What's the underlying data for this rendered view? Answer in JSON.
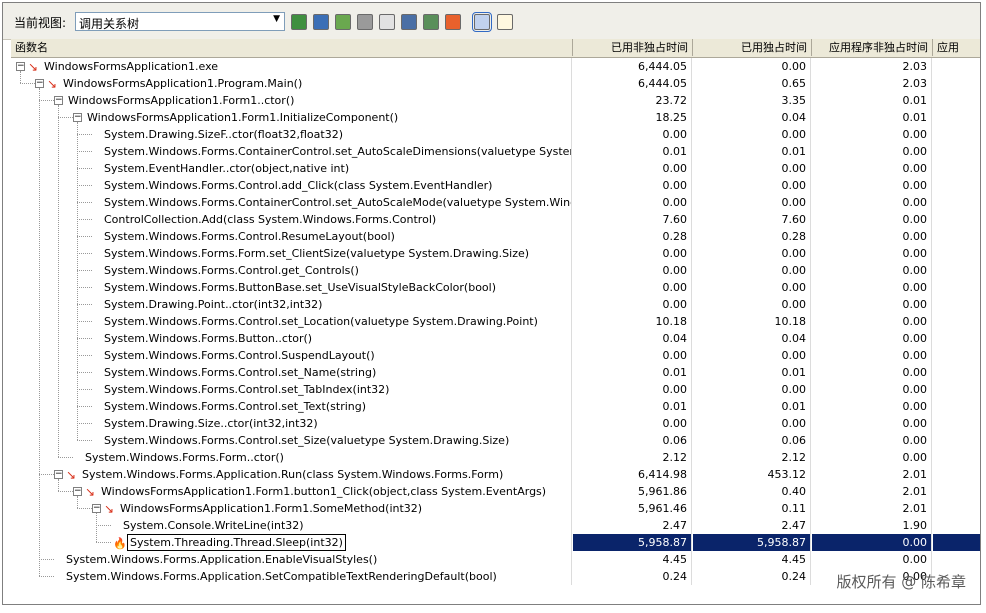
{
  "toolbar": {
    "view_label": "当前视图:",
    "view_value": "调用关系树",
    "buttons": [
      "export-icon",
      "copy-icon",
      "run-icon",
      "stop-icon",
      "find-icon",
      "compare-icon",
      "open-icon",
      "hotpath-icon",
      "flame-toggle-icon",
      "notes-icon"
    ]
  },
  "columns": [
    "函数名",
    "已用非独占时间",
    "已用独占时间",
    "应用程序非独占时间",
    "应用"
  ],
  "rows": [
    {
      "name": "WindowsFormsApplication1.exe",
      "v1": "6,444.05",
      "v2": "0.00",
      "v3": "2.03",
      "level": 0,
      "toggle": true,
      "hot": true
    },
    {
      "name": "WindowsFormsApplication1.Program.Main()",
      "v1": "6,444.05",
      "v2": "0.65",
      "v3": "2.03",
      "level": 1,
      "toggle": true,
      "hot": true
    },
    {
      "name": "WindowsFormsApplication1.Form1..ctor()",
      "v1": "23.72",
      "v2": "3.35",
      "v3": "0.01",
      "level": 2,
      "toggle": true,
      "hot": false
    },
    {
      "name": "WindowsFormsApplication1.Form1.InitializeComponent()",
      "v1": "18.25",
      "v2": "0.04",
      "v3": "0.01",
      "level": 3,
      "toggle": true,
      "hot": false
    },
    {
      "name": "System.Drawing.SizeF..ctor(float32,float32)",
      "v1": "0.00",
      "v2": "0.00",
      "v3": "0.00",
      "level": 4,
      "toggle": false,
      "hot": false
    },
    {
      "name": "System.Windows.Forms.ContainerControl.set_AutoScaleDimensions(valuetype System.Drawing",
      "v1": "0.01",
      "v2": "0.01",
      "v3": "0.00",
      "level": 4,
      "toggle": false,
      "hot": false
    },
    {
      "name": "System.EventHandler..ctor(object,native int)",
      "v1": "0.00",
      "v2": "0.00",
      "v3": "0.00",
      "level": 4,
      "toggle": false,
      "hot": false
    },
    {
      "name": "System.Windows.Forms.Control.add_Click(class System.EventHandler)",
      "v1": "0.00",
      "v2": "0.00",
      "v3": "0.00",
      "level": 4,
      "toggle": false,
      "hot": false
    },
    {
      "name": "System.Windows.Forms.ContainerControl.set_AutoScaleMode(valuetype System.Windows.Form",
      "v1": "0.00",
      "v2": "0.00",
      "v3": "0.00",
      "level": 4,
      "toggle": false,
      "hot": false
    },
    {
      "name": "ControlCollection.Add(class System.Windows.Forms.Control)",
      "v1": "7.60",
      "v2": "7.60",
      "v3": "0.00",
      "level": 4,
      "toggle": false,
      "hot": false
    },
    {
      "name": "System.Windows.Forms.Control.ResumeLayout(bool)",
      "v1": "0.28",
      "v2": "0.28",
      "v3": "0.00",
      "level": 4,
      "toggle": false,
      "hot": false
    },
    {
      "name": "System.Windows.Forms.Form.set_ClientSize(valuetype System.Drawing.Size)",
      "v1": "0.00",
      "v2": "0.00",
      "v3": "0.00",
      "level": 4,
      "toggle": false,
      "hot": false
    },
    {
      "name": "System.Windows.Forms.Control.get_Controls()",
      "v1": "0.00",
      "v2": "0.00",
      "v3": "0.00",
      "level": 4,
      "toggle": false,
      "hot": false
    },
    {
      "name": "System.Windows.Forms.ButtonBase.set_UseVisualStyleBackColor(bool)",
      "v1": "0.00",
      "v2": "0.00",
      "v3": "0.00",
      "level": 4,
      "toggle": false,
      "hot": false
    },
    {
      "name": "System.Drawing.Point..ctor(int32,int32)",
      "v1": "0.00",
      "v2": "0.00",
      "v3": "0.00",
      "level": 4,
      "toggle": false,
      "hot": false
    },
    {
      "name": "System.Windows.Forms.Control.set_Location(valuetype System.Drawing.Point)",
      "v1": "10.18",
      "v2": "10.18",
      "v3": "0.00",
      "level": 4,
      "toggle": false,
      "hot": false
    },
    {
      "name": "System.Windows.Forms.Button..ctor()",
      "v1": "0.04",
      "v2": "0.04",
      "v3": "0.00",
      "level": 4,
      "toggle": false,
      "hot": false
    },
    {
      "name": "System.Windows.Forms.Control.SuspendLayout()",
      "v1": "0.00",
      "v2": "0.00",
      "v3": "0.00",
      "level": 4,
      "toggle": false,
      "hot": false
    },
    {
      "name": "System.Windows.Forms.Control.set_Name(string)",
      "v1": "0.01",
      "v2": "0.01",
      "v3": "0.00",
      "level": 4,
      "toggle": false,
      "hot": false
    },
    {
      "name": "System.Windows.Forms.Control.set_TabIndex(int32)",
      "v1": "0.00",
      "v2": "0.00",
      "v3": "0.00",
      "level": 4,
      "toggle": false,
      "hot": false
    },
    {
      "name": "System.Windows.Forms.Control.set_Text(string)",
      "v1": "0.01",
      "v2": "0.01",
      "v3": "0.00",
      "level": 4,
      "toggle": false,
      "hot": false
    },
    {
      "name": "System.Drawing.Size..ctor(int32,int32)",
      "v1": "0.00",
      "v2": "0.00",
      "v3": "0.00",
      "level": 4,
      "toggle": false,
      "hot": false
    },
    {
      "name": "System.Windows.Forms.Control.set_Size(valuetype System.Drawing.Size)",
      "v1": "0.06",
      "v2": "0.06",
      "v3": "0.00",
      "level": 4,
      "toggle": false,
      "hot": false
    },
    {
      "name": "System.Windows.Forms.Form..ctor()",
      "v1": "2.12",
      "v2": "2.12",
      "v3": "0.00",
      "level": 3,
      "toggle": false,
      "hot": false
    },
    {
      "name": "System.Windows.Forms.Application.Run(class System.Windows.Forms.Form)",
      "v1": "6,414.98",
      "v2": "453.12",
      "v3": "2.01",
      "level": 2,
      "toggle": true,
      "hot": true
    },
    {
      "name": "WindowsFormsApplication1.Form1.button1_Click(object,class System.EventArgs)",
      "v1": "5,961.86",
      "v2": "0.40",
      "v3": "2.01",
      "level": 3,
      "toggle": true,
      "hot": true
    },
    {
      "name": "WindowsFormsApplication1.Form1.SomeMethod(int32)",
      "v1": "5,961.46",
      "v2": "0.11",
      "v3": "2.01",
      "level": 4,
      "toggle": true,
      "hot": true
    },
    {
      "name": "System.Console.WriteLine(int32)",
      "v1": "2.47",
      "v2": "2.47",
      "v3": "1.90",
      "level": 5,
      "toggle": false,
      "hot": false
    },
    {
      "name": "System.Threading.Thread.Sleep(int32)",
      "v1": "5,958.87",
      "v2": "5,958.87",
      "v3": "0.00",
      "level": 5,
      "toggle": false,
      "hot": false,
      "flame": true,
      "selected": true
    },
    {
      "name": "System.Windows.Forms.Application.EnableVisualStyles()",
      "v1": "4.45",
      "v2": "4.45",
      "v3": "0.00",
      "level": 2,
      "toggle": false,
      "hot": false
    },
    {
      "name": "System.Windows.Forms.Application.SetCompatibleTextRenderingDefault(bool)",
      "v1": "0.24",
      "v2": "0.24",
      "v3": "0.00",
      "level": 2,
      "toggle": false,
      "hot": false
    }
  ],
  "watermark": "版权所有 @ 陈希章"
}
